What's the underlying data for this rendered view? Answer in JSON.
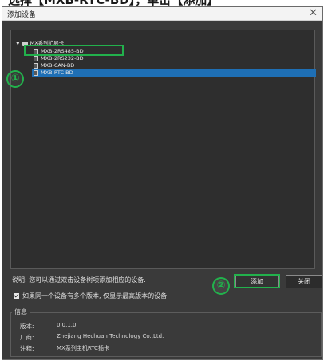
{
  "caption": "选择【MXB-RTC-BD】，单击【添加】",
  "dialog": {
    "title": "添加设备",
    "close_icon": "close-icon"
  },
  "tree": {
    "root_label": "MX系列扩展卡",
    "items": [
      {
        "label": "MXB-2RS485-BD"
      },
      {
        "label": "MXB-2RS232-BD"
      },
      {
        "label": "MXB-CAN-BD"
      },
      {
        "label": "MXB-RTC-BD",
        "selected": true
      }
    ]
  },
  "annotations": {
    "marker1": "①",
    "marker2": "②",
    "highlight_color": "#22b14c"
  },
  "footer": {
    "description": "说明: 您可以通过双击设备树项添加相应的设备.",
    "add_button": "添加",
    "close_button": "关闭",
    "checkbox_label": "如果同一个设备有多个版本, 仅显示最高版本的设备",
    "checkbox_checked": true
  },
  "info": {
    "legend": "信息",
    "version_label": "版本:",
    "version_value": "0.0.1.0",
    "vendor_label": "厂商:",
    "vendor_value": "Zhejiang Hechuan Technology Co.,Ltd.",
    "note_label": "注释:",
    "note_value": "MX系列主机RTC插卡"
  },
  "colors": {
    "selection": "#1e6fb5",
    "background": "#3a3a3a"
  }
}
